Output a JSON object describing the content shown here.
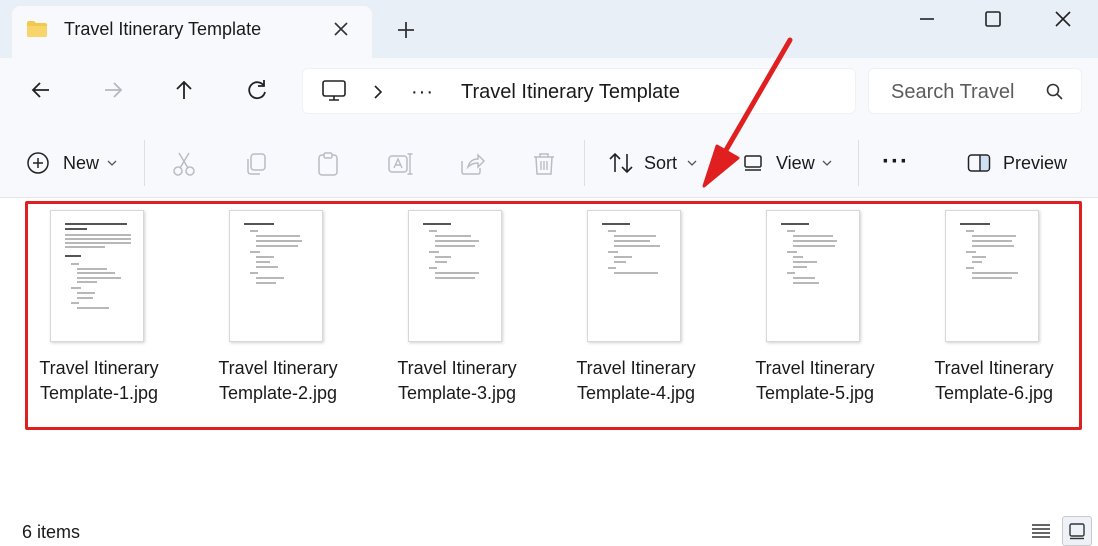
{
  "window": {
    "tab_title": "Travel Itinerary Template",
    "new_tab_symbol": "+"
  },
  "nav": {
    "breadcrumb_more": "···",
    "address_text": "Travel Itinerary Template",
    "search_placeholder": "Search Travel"
  },
  "toolbar": {
    "new_label": "New",
    "sort_label": "Sort",
    "view_label": "View",
    "more_label": "···",
    "preview_label": "Preview"
  },
  "files": [
    {
      "line1": "Travel Itinerary",
      "line2": "Template-1.jpg"
    },
    {
      "line1": "Travel Itinerary",
      "line2": "Template-2.jpg"
    },
    {
      "line1": "Travel Itinerary",
      "line2": "Template-3.jpg"
    },
    {
      "line1": "Travel Itinerary",
      "line2": "Template-4.jpg"
    },
    {
      "line1": "Travel Itinerary",
      "line2": "Template-5.jpg"
    },
    {
      "line1": "Travel Itinerary",
      "line2": "Template-6.jpg"
    }
  ],
  "status": {
    "item_count": "6 items"
  },
  "colors": {
    "highlight_border": "#e02020",
    "annotation_arrow": "#e02020",
    "folder_icon": "#f2c94c",
    "accent": "#0067c0"
  },
  "icons": {
    "tab": "folder-icon",
    "cut": "scissors-icon",
    "copy": "copy-icon",
    "paste": "clipboard-icon",
    "rename": "rename-icon",
    "share": "share-icon",
    "delete": "trash-icon"
  }
}
